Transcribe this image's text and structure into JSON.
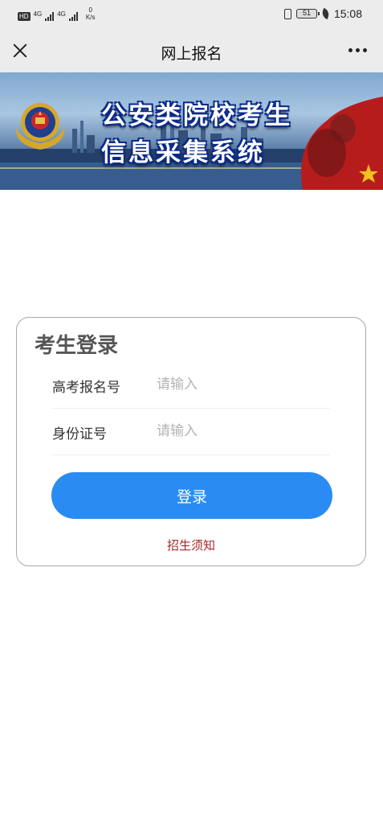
{
  "status_bar": {
    "hd": "HD",
    "net1": "4G",
    "net2": "4G",
    "speed_value": "0",
    "speed_unit": "K/s",
    "battery": "51",
    "time": "15:08"
  },
  "title_bar": {
    "title": "网上报名"
  },
  "banner": {
    "line1": "公安类院校考生",
    "line2": "信息采集系统"
  },
  "login": {
    "title": "考生登录",
    "fields": [
      {
        "label": "高考报名号",
        "placeholder": "请输入",
        "value": ""
      },
      {
        "label": "身份证号",
        "placeholder": "请输入",
        "value": ""
      }
    ],
    "submit_label": "登录",
    "notice_link": "招生须知"
  },
  "colors": {
    "primary_button": "#2a8cf2",
    "notice_link": "#a5282b",
    "bar_background": "#ececec"
  }
}
